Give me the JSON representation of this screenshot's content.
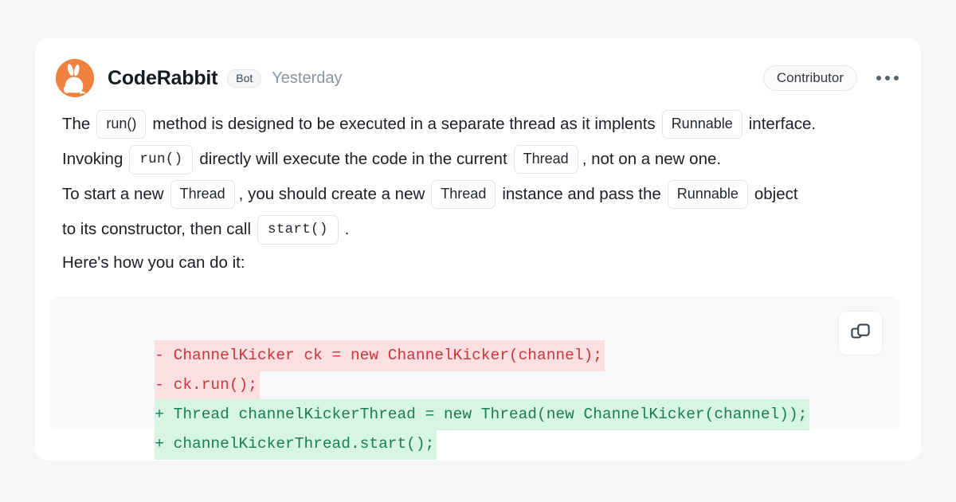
{
  "header": {
    "avatar_icon": "rabbit-avatar-icon",
    "author": "CodeRabbit",
    "bot_label": "Bot",
    "timestamp": "Yesterday",
    "contributor_label": "Contributor",
    "menu_icon": "kebab-menu-icon"
  },
  "body": {
    "line1": {
      "t1": "The",
      "chip1": "run()",
      "t2": "method is designed to be executed in a separate thread as it implents",
      "chip2": "Runnable",
      "t3": "interface."
    },
    "line2": {
      "t1": "Invoking",
      "chip1": "run()",
      "t2": "directly will execute the code in the current",
      "chip2": "Thread",
      "t3": ", not on a new one."
    },
    "line3": {
      "t1": "To start a new",
      "chip1": "Thread",
      "t2": ", you should create a new",
      "chip2": "Thread",
      "t3": "instance and pass the",
      "chip3": "Runnable",
      "t4": "object"
    },
    "line4": {
      "t1": "to its constructor, then call",
      "chip1": "start()",
      "t2": "."
    },
    "line5": "Here's how you can do it:"
  },
  "code": {
    "copy_icon": "copy-icon",
    "lines": [
      {
        "marker": "-",
        "text": "ChannelKicker ck = new ChannelKicker(channel);",
        "type": "del"
      },
      {
        "marker": "-",
        "text": "ck.run();",
        "type": "del"
      },
      {
        "marker": "+",
        "text": "Thread channelKickerThread = new Thread(new ChannelKicker(channel));",
        "type": "add"
      },
      {
        "marker": "+",
        "text": "channelKickerThread.start();",
        "type": "add"
      }
    ]
  },
  "colors": {
    "page_bg": "#f4f6f7",
    "card_bg": "#ffffff",
    "avatar_orange": "#f0813f",
    "code_bg": "#f6f8f9",
    "del_text": "#c9373d",
    "del_bg": "#fbdfe1",
    "add_text": "#1a7f4b",
    "add_bg": "#d7f5e3"
  }
}
